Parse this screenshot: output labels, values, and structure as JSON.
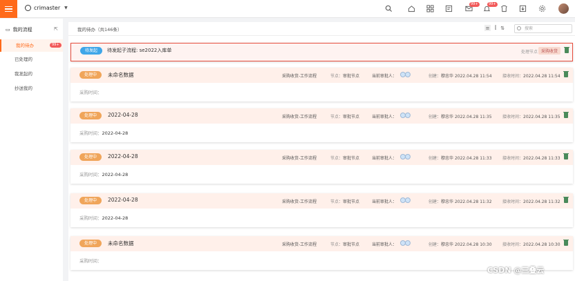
{
  "header": {
    "username": "crimaster",
    "badges": {
      "bell": "99+",
      "mail": "99+"
    }
  },
  "sidebar": {
    "title": "我的流程",
    "items": [
      {
        "label": "我的待办",
        "badge": "99+",
        "active": true
      },
      {
        "label": "已处理的"
      },
      {
        "label": "我发起的"
      },
      {
        "label": "抄送我的"
      }
    ]
  },
  "main": {
    "title": "我的待办（共146条）",
    "search_placeholder": "搜索"
  },
  "highlight_card": {
    "status": "待发起",
    "title": "待发起子流程: se2022入库单",
    "node_label": "处理节点",
    "node_value": "采购收货"
  },
  "cards": [
    {
      "status": "处理中",
      "title": "未命名数据",
      "flow": "采购收货-工作流程",
      "node": "审批节点",
      "approver_label": "当前审批人：",
      "creator_label": "创建：",
      "creator": "穆忠华",
      "created": "2022.04.28 11:54",
      "received_label": "接收时间：",
      "received": "2022.04.28 11:54",
      "field_label": "采购时间：",
      "field_value": ""
    },
    {
      "status": "处理中",
      "title": "2022-04-28",
      "flow": "采购收货-工作流程",
      "node": "审批节点",
      "approver_label": "当前审批人：",
      "creator_label": "创建：",
      "creator": "穆忠华",
      "created": "2022.04.28 11:35",
      "received_label": "接收时间：",
      "received": "2022.04.28 11:35",
      "field_label": "采购时间：",
      "field_value": "2022-04-28"
    },
    {
      "status": "处理中",
      "title": "2022-04-28",
      "flow": "采购收货-工作流程",
      "node": "审批节点",
      "approver_label": "当前审批人：",
      "creator_label": "创建：",
      "creator": "穆忠华",
      "created": "2022.04.28 11:33",
      "received_label": "接收时间：",
      "received": "2022.04.28 11:33",
      "field_label": "采购时间：",
      "field_value": "2022-04-28"
    },
    {
      "status": "处理中",
      "title": "2022-04-28",
      "flow": "采购收货-工作流程",
      "node": "审批节点",
      "approver_label": "当前审批人：",
      "creator_label": "创建：",
      "creator": "穆忠华",
      "created": "2022.04.28 11:32",
      "received_label": "接收时间：",
      "received": "2022.04.28 11:32",
      "field_label": "采购时间：",
      "field_value": "2022-04-28"
    },
    {
      "status": "处理中",
      "title": "未命名数据",
      "flow": "采购收货-工作流程",
      "node": "审批节点",
      "approver_label": "当前审批人：",
      "creator_label": "创建：",
      "creator": "穆忠华",
      "created": "2022.04.28 10:30",
      "received_label": "接收时间：",
      "received": "2022.04.28 10:30",
      "field_label": "采购时间：",
      "field_value": ""
    }
  ],
  "node_prefix": "节点：",
  "watermark": "CSDN @三叠云",
  "colors": {
    "accent": "#ff6a1a",
    "status_processing": "#f0a55a",
    "status_pending": "#3fa6e8",
    "highlight_border": "#e74c3c"
  }
}
